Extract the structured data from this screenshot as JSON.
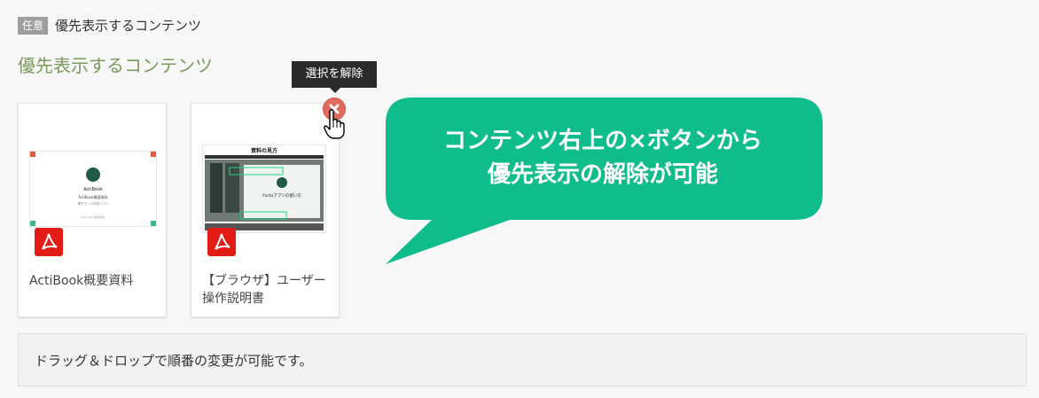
{
  "header": {
    "badge": "任意",
    "label": "優先表示するコンテンツ",
    "section_title": "優先表示するコンテンツ"
  },
  "tooltip": {
    "text": "選択を解除"
  },
  "cards": [
    {
      "title": "ActiBook概要資料",
      "thumb": {
        "brand": "ActiBook",
        "line1": "ActiBook概要資料",
        "line2": "電子ブック作成ソフト",
        "footer": "Copyright 株式会社"
      }
    },
    {
      "title": "【ブラウザ】ユーザー操作説明書",
      "thumb": {
        "heading": "資料の見方",
        "sub": "Fostaアプリの使い方"
      }
    }
  ],
  "callout": {
    "line1": "コンテンツ右上の×ボタンから",
    "line2": "優先表示の解除が可能"
  },
  "note": {
    "text": "ドラッグ＆ドロップで順番の変更が可能です。"
  },
  "colors": {
    "accent_green": "#7a9a5e",
    "callout": "#0fbd8c",
    "pdf_red": "#e21b14",
    "remove": "#e06a5d"
  },
  "icons": {
    "file": "pdf-icon",
    "remove": "close-circle-icon",
    "pointer": "hand-cursor-icon"
  }
}
